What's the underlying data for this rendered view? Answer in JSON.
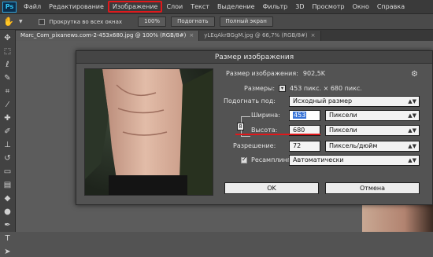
{
  "menubar": {
    "logo": "Ps",
    "items": [
      "Файл",
      "Редактирование",
      "Изображение",
      "Слои",
      "Текст",
      "Выделение",
      "Фильтр",
      "3D",
      "Просмотр",
      "Окно",
      "Справка"
    ]
  },
  "options": {
    "scroll_all_label": "Прокрутка во всех окнах",
    "zoom_btn": "100%",
    "fit_btn": "Подогнать",
    "fullscreen_btn": "Полный экран"
  },
  "tabs": [
    {
      "label": "Marc_Com_pixanews.com-2-453x680.jpg @ 100% (RGB/8#)",
      "active": true
    },
    {
      "label": "yLEqAkrBGgM.jpg @ 66,7% (RGB/8#)",
      "active": false
    }
  ],
  "dialog": {
    "title": "Размер изображения",
    "image_size_label": "Размер изображения:",
    "image_size_value": "902,5K",
    "dimensions_label": "Размеры:",
    "dimensions_value": "453 пикс. × 680 пикс.",
    "fit_label": "Подогнать под:",
    "fit_value": "Исходный размер",
    "width_label": "Ширина:",
    "width_value": "453",
    "width_unit": "Пиксели",
    "height_label": "Высота:",
    "height_value": "680",
    "height_unit": "Пиксели",
    "resolution_label": "Разрешение:",
    "resolution_value": "72",
    "resolution_unit": "Пиксель/дюйм",
    "resample_label": "Ресамплинг:",
    "resample_value": "Автоматически",
    "ok": "OK",
    "cancel": "Отмена"
  },
  "colors": {
    "highlight": "#e0181b",
    "selection": "#3874d8"
  }
}
